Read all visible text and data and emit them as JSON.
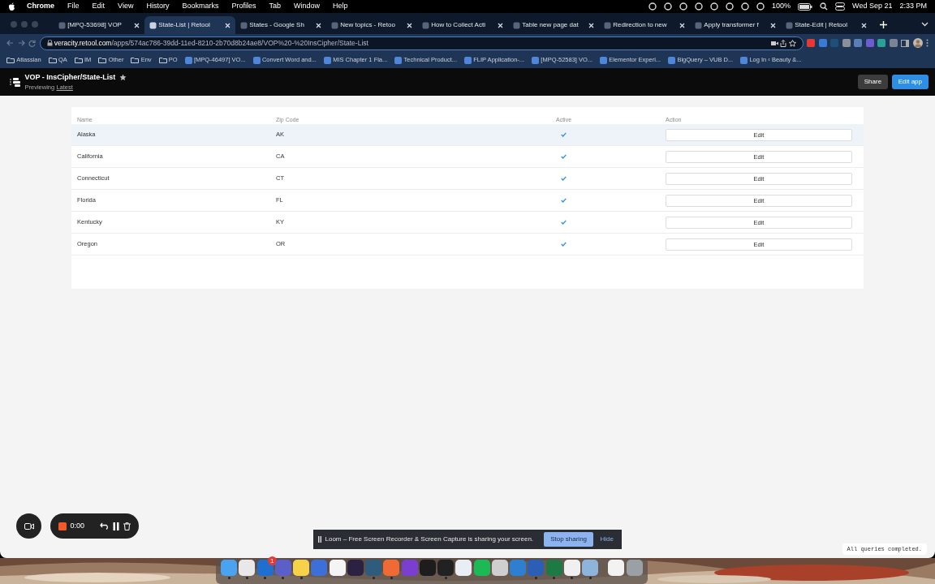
{
  "menubar": {
    "app": "Chrome",
    "menus": [
      "File",
      "Edit",
      "View",
      "History",
      "Bookmarks",
      "Profiles",
      "Tab",
      "Window",
      "Help"
    ],
    "battery": "100%",
    "date": "Wed Sep 21",
    "time": "2:33 PM"
  },
  "tabs": [
    {
      "title": "[MPQ-53698] VOP",
      "selected": false
    },
    {
      "title": "State-List | Retool",
      "selected": true
    },
    {
      "title": "States - Google Sh",
      "selected": false
    },
    {
      "title": "New topics - Retoo",
      "selected": false
    },
    {
      "title": "How to Collect Acti",
      "selected": false
    },
    {
      "title": "Table new page dat",
      "selected": false
    },
    {
      "title": "Redirection to new",
      "selected": false
    },
    {
      "title": "Apply transformer f",
      "selected": false
    },
    {
      "title": "State-Edit | Retool",
      "selected": false
    }
  ],
  "address": {
    "host": "veracity.retool.com",
    "path": "/apps/574ac786-39dd-11ed-8210-2b70d8b24ae8/VOP%20-%20InsCipher/State-List"
  },
  "bookmarks": [
    {
      "kind": "folder",
      "label": "Atlassian"
    },
    {
      "kind": "folder",
      "label": "QA"
    },
    {
      "kind": "folder",
      "label": "IM"
    },
    {
      "kind": "folder",
      "label": "Other"
    },
    {
      "kind": "folder",
      "label": "Env"
    },
    {
      "kind": "folder",
      "label": "PO"
    },
    {
      "kind": "link",
      "label": "[MPQ-46497] VO..."
    },
    {
      "kind": "link",
      "label": "Convert Word and..."
    },
    {
      "kind": "link",
      "label": "MIS Chapter 1 Fla..."
    },
    {
      "kind": "link",
      "label": "Technical Product..."
    },
    {
      "kind": "link",
      "label": "FLIP Application-..."
    },
    {
      "kind": "link",
      "label": "[MPQ-52583] VO..."
    },
    {
      "kind": "link",
      "label": "Elementor Experi..."
    },
    {
      "kind": "link",
      "label": "BigQuery – VUB D..."
    },
    {
      "kind": "link",
      "label": "Log In ‹ Beauty &..."
    }
  ],
  "app_header": {
    "title": "VOP - InsCipher/State-List",
    "previewing": "Previewing",
    "version": "Latest",
    "buttons": [
      "Share",
      "Edit app"
    ]
  },
  "table": {
    "columns": [
      "Name",
      "Zip Code",
      "Active",
      "Action"
    ],
    "rows": [
      {
        "name": "Alaska",
        "zip": "AK",
        "active": true,
        "action": "Edit",
        "selected": true
      },
      {
        "name": "California",
        "zip": "CA",
        "active": true,
        "action": "Edit",
        "selected": false
      },
      {
        "name": "Connecticut",
        "zip": "CT",
        "active": true,
        "action": "Edit",
        "selected": false
      },
      {
        "name": "Florida",
        "zip": "FL",
        "active": true,
        "action": "Edit",
        "selected": false
      },
      {
        "name": "Kentucky",
        "zip": "KY",
        "active": true,
        "action": "Edit",
        "selected": false
      },
      {
        "name": "Oregon",
        "zip": "OR",
        "active": true,
        "action": "Edit",
        "selected": false
      }
    ]
  },
  "recorder": {
    "timer": "0:00"
  },
  "sharing_banner": {
    "message": "Loom – Free Screen Recorder & Screen Capture is sharing your screen.",
    "buttons": [
      "Stop sharing",
      "Hide"
    ]
  },
  "status": "All queries completed.",
  "dock": [
    {
      "running": true
    },
    {
      "running": true
    },
    {
      "running": true,
      "badge": "1"
    },
    {
      "running": true
    },
    {
      "running": true
    },
    {
      "running": false
    },
    {
      "running": false
    },
    {
      "running": false
    },
    {
      "running": true
    },
    {
      "running": true
    },
    {
      "running": false
    },
    {
      "running": false
    },
    {
      "running": true
    },
    {
      "running": false
    },
    {
      "running": false
    },
    {
      "running": false
    },
    {
      "running": false
    },
    {
      "running": true
    },
    {
      "running": true
    },
    {
      "running": true
    },
    {
      "running": true
    },
    {
      "running": false
    },
    {
      "running": false
    }
  ]
}
